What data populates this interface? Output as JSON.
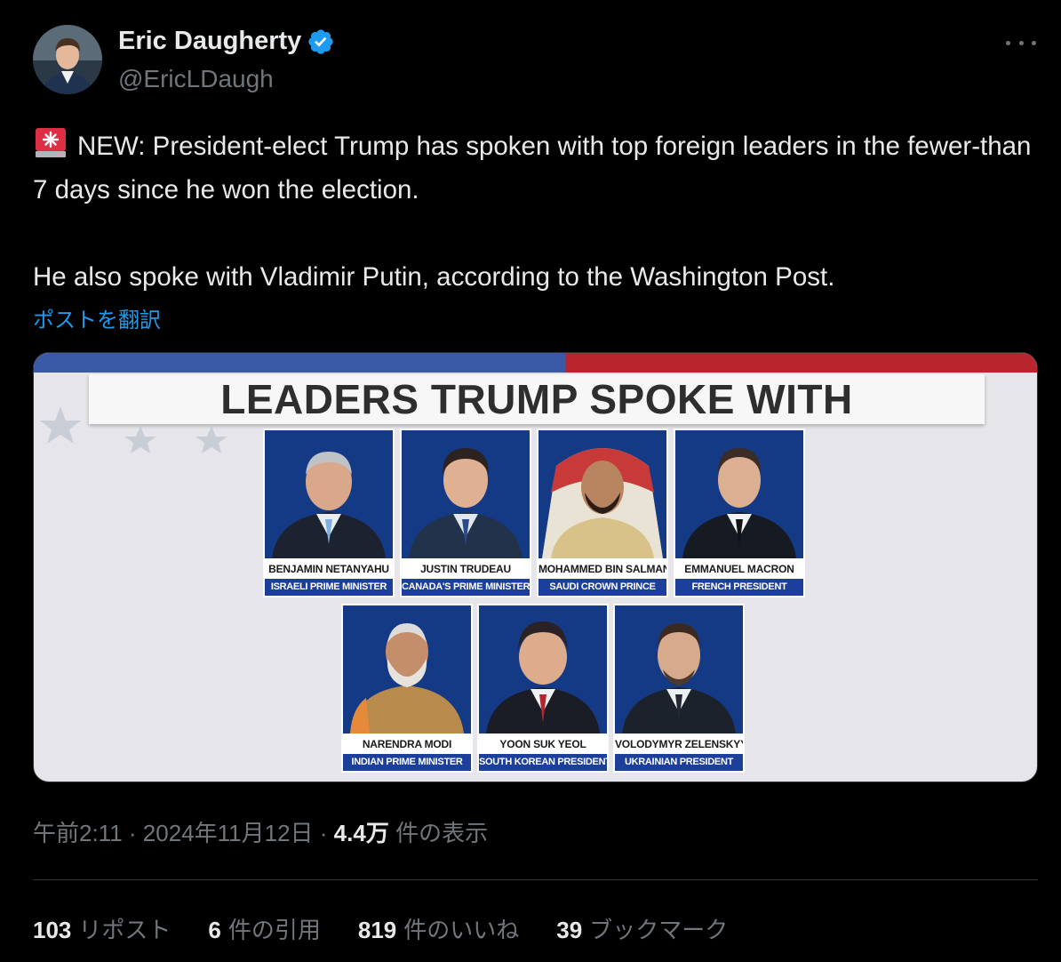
{
  "author": {
    "name": "Eric Daugherty",
    "handle": "@EricLDaugh",
    "verified": true
  },
  "tweet": {
    "line1": "NEW: President-elect Trump has spoken with top foreign leaders in the fewer-than 7 days since he won the election.",
    "line2": "He also spoke with Vladimir Putin, according to the Washington Post.",
    "translate_label": "ポストを翻訳"
  },
  "media": {
    "headline": "LEADERS TRUMP SPOKE WITH",
    "leaders": [
      {
        "name": "BENJAMIN NETANYAHU",
        "title": "ISRAELI PRIME MINISTER"
      },
      {
        "name": "JUSTIN TRUDEAU",
        "title": "CANADA'S PRIME MINISTER"
      },
      {
        "name": "MOHAMMED BIN SALMAN",
        "title": "SAUDI CROWN PRINCE"
      },
      {
        "name": "EMMANUEL MACRON",
        "title": "FRENCH PRESIDENT"
      },
      {
        "name": "NARENDRA MODI",
        "title": "INDIAN PRIME MINISTER"
      },
      {
        "name": "YOON SUK YEOL",
        "title": "SOUTH KOREAN PRESIDENT"
      },
      {
        "name": "VOLODYMYR ZELENSKYY",
        "title": "UKRAINIAN PRESIDENT"
      }
    ]
  },
  "meta": {
    "time": "午前2:11",
    "separator": " · ",
    "date": "2024年11月12日",
    "views_count": "4.4万",
    "views_label": "件の表示"
  },
  "stats": {
    "reposts_count": "103",
    "reposts_label": "リポスト",
    "quotes_count": "6",
    "quotes_label": "件の引用",
    "likes_count": "819",
    "likes_label": "件のいいね",
    "bookmarks_count": "39",
    "bookmarks_label": "ブックマーク"
  },
  "colors": {
    "background": "#000000",
    "text": "#e7e9ea",
    "muted": "#71767b",
    "link": "#1d9bf0",
    "verified": "#1d9bf0",
    "chyron_blue": "#1b3f9a"
  },
  "icons": [
    "verified-badge-icon",
    "more-options-icon",
    "siren-icon"
  ]
}
